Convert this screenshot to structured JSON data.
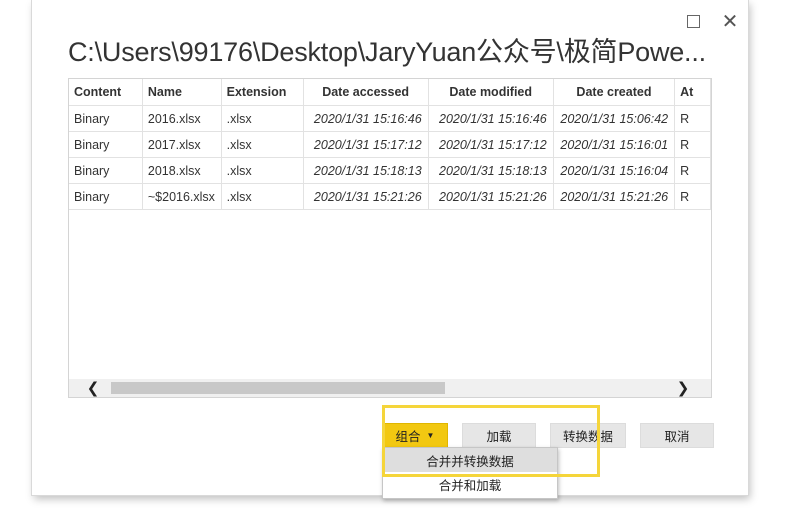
{
  "window": {
    "title": "C:\\Users\\99176\\Desktop\\JaryYuan公众号\\极简Powe...",
    "maximize_icon": "maximize-icon",
    "close_icon": "close-icon",
    "close_glyph": "✕"
  },
  "table": {
    "columns": [
      "Content",
      "Name",
      "Extension",
      "Date accessed",
      "Date modified",
      "Date created",
      "At"
    ],
    "rows": [
      [
        "Binary",
        "2016.xlsx",
        ".xlsx",
        "2020/1/31 15:16:46",
        "2020/1/31 15:16:46",
        "2020/1/31 15:06:42",
        "R"
      ],
      [
        "Binary",
        "2017.xlsx",
        ".xlsx",
        "2020/1/31 15:17:12",
        "2020/1/31 15:17:12",
        "2020/1/31 15:16:01",
        "R"
      ],
      [
        "Binary",
        "2018.xlsx",
        ".xlsx",
        "2020/1/31 15:18:13",
        "2020/1/31 15:18:13",
        "2020/1/31 15:16:04",
        "R"
      ],
      [
        "Binary",
        "~$2016.xlsx",
        ".xlsx",
        "2020/1/31 15:21:26",
        "2020/1/31 15:21:26",
        "2020/1/31 15:21:26",
        "R"
      ]
    ]
  },
  "scrollbar": {
    "left_arrow": "❮",
    "right_arrow": "❯"
  },
  "buttons": {
    "combine_label": "组合",
    "combine_caret": "▼",
    "load_label": "加载",
    "transform_label": "转换数据",
    "cancel_label": "取消"
  },
  "combine_menu": {
    "items": [
      "合并并转换数据",
      "合并和加载"
    ],
    "hovered_index": 0
  },
  "colors": {
    "accent": "#f2c811",
    "highlight_border": "#f5d53a"
  }
}
